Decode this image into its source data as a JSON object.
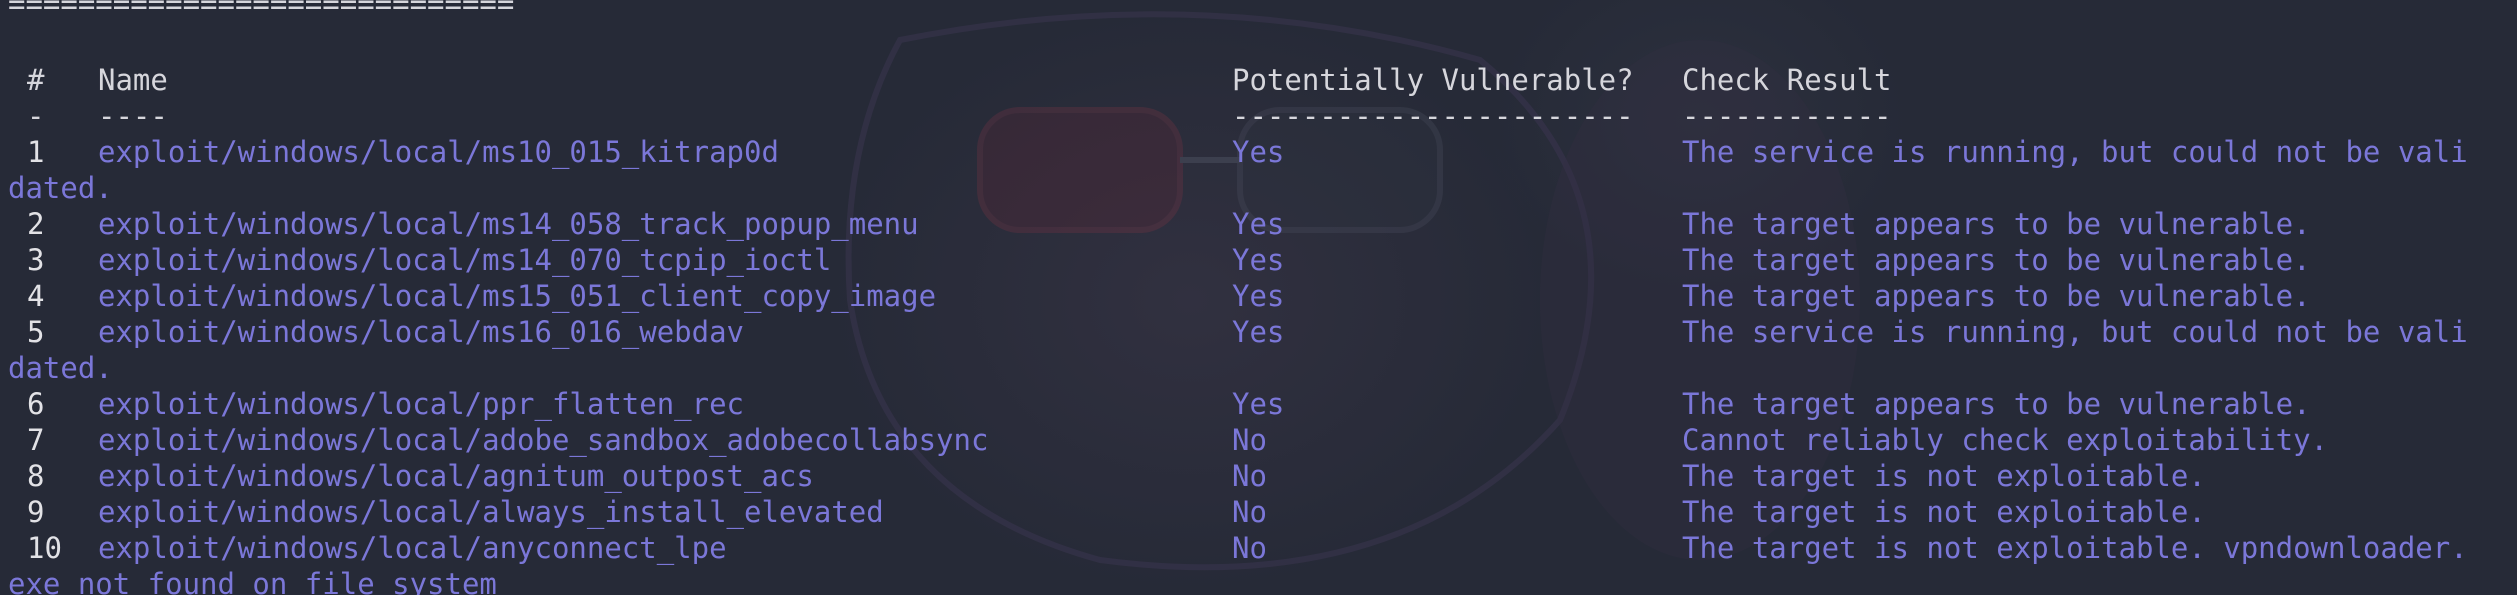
{
  "separator": "=============================",
  "headers": {
    "num": "#",
    "name": "Name",
    "vuln": "Potentially Vulnerable?",
    "result": "Check Result"
  },
  "underlines": {
    "num": "-",
    "name": "----",
    "vuln": "-----------------------",
    "result": "------------"
  },
  "rows": [
    {
      "num": "1",
      "name": "exploit/windows/local/ms10_015_kitrap0d",
      "vuln": "Yes",
      "result": "The service is running, but could not be vali",
      "cont": "dated."
    },
    {
      "num": "2",
      "name": "exploit/windows/local/ms14_058_track_popup_menu",
      "vuln": "Yes",
      "result": "The target appears to be vulnerable."
    },
    {
      "num": "3",
      "name": "exploit/windows/local/ms14_070_tcpip_ioctl",
      "vuln": "Yes",
      "result": "The target appears to be vulnerable."
    },
    {
      "num": "4",
      "name": "exploit/windows/local/ms15_051_client_copy_image",
      "vuln": "Yes",
      "result": "The target appears to be vulnerable."
    },
    {
      "num": "5",
      "name": "exploit/windows/local/ms16_016_webdav",
      "vuln": "Yes",
      "result": "The service is running, but could not be vali",
      "cont": "dated."
    },
    {
      "num": "6",
      "name": "exploit/windows/local/ppr_flatten_rec",
      "vuln": "Yes",
      "result": "The target appears to be vulnerable."
    },
    {
      "num": "7",
      "name": "exploit/windows/local/adobe_sandbox_adobecollabsync",
      "vuln": "No",
      "result": "Cannot reliably check exploitability."
    },
    {
      "num": "8",
      "name": "exploit/windows/local/agnitum_outpost_acs",
      "vuln": "No",
      "result": "The target is not exploitable."
    },
    {
      "num": "9",
      "name": "exploit/windows/local/always_install_elevated",
      "vuln": "No",
      "result": "The target is not exploitable."
    },
    {
      "num": "10",
      "name": "exploit/windows/local/anyconnect_lpe",
      "vuln": "No",
      "result": "The target is not exploitable. vpndownloader.",
      "cont": "exe not found on file system"
    }
  ],
  "colors": {
    "background": "#262a37",
    "text": "#d6d6dc",
    "accent": "#7b77d8"
  }
}
